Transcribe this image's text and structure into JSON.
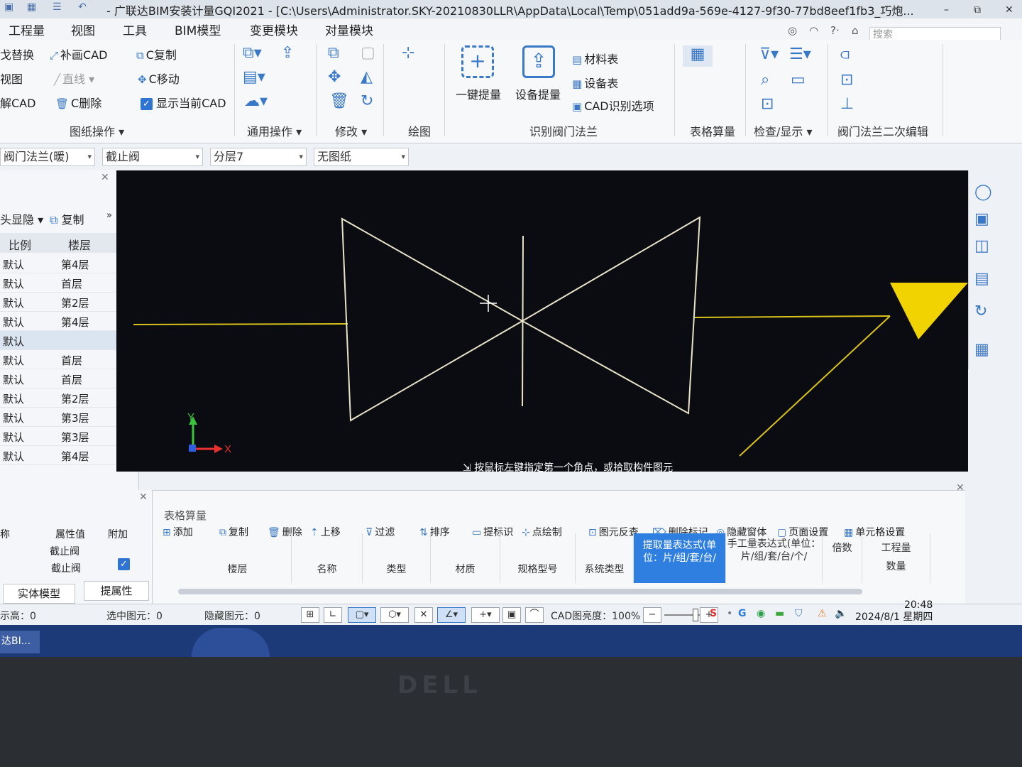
{
  "titlebar": {
    "title": "- 广联达BIM安装计量GQI2021 - [C:\\Users\\Administrator.SKY-20210830LLR\\AppData\\Local\\Temp\\051add9a-569e-4127-9f30-77bd8eef1fb3_巧炮...",
    "minimize": "–",
    "restore": "⧉",
    "close": "✕"
  },
  "menubar": {
    "items": [
      "工程量",
      "视图",
      "工具",
      "BIM模型",
      "变更模块",
      "对量模块"
    ],
    "search_placeholder": "搜索"
  },
  "ribbon": {
    "drawing": {
      "btn1": "戈替换",
      "btn2": "视图",
      "btn3": "解CAD",
      "btn4": "补画CAD",
      "btn5": "直线",
      "btn6": "C删除",
      "btn7": "C复制",
      "btn8": "C移动",
      "btn9": "显示当前CAD",
      "group": "图纸操作"
    },
    "general_group": "通用操作",
    "modify_group": "修改",
    "draw_group": "绘图",
    "recognize": {
      "one_key": "一键提量",
      "device": "设备提量",
      "material_table": "材料表",
      "device_table": "设备表",
      "cad_options": "CAD识别选项",
      "group": "识别阀门法兰"
    },
    "table_group": "表格算量",
    "check_group": "检查/显示",
    "secondary_group": "阀门法兰二次编辑"
  },
  "selectors": [
    "阀门法兰(暖)",
    "截止阀",
    "分层7",
    "无图纸"
  ],
  "leftpanel": {
    "toolbar": {
      "show_hide": "头显隐",
      "copy": "复制"
    },
    "headers": [
      "比例",
      "楼层"
    ],
    "rows": [
      {
        "scale": "默认",
        "floor": "第4层"
      },
      {
        "scale": "默认",
        "floor": "首层"
      },
      {
        "scale": "默认",
        "floor": "第2层"
      },
      {
        "scale": "默认",
        "floor": "第4层"
      },
      {
        "scale": "默认",
        "floor": ""
      },
      {
        "scale": "默认",
        "floor": "首层"
      },
      {
        "scale": "默认",
        "floor": "首层"
      },
      {
        "scale": "默认",
        "floor": "第2层"
      },
      {
        "scale": "默认",
        "floor": "第3层"
      },
      {
        "scale": "默认",
        "floor": "第3层"
      },
      {
        "scale": "默认",
        "floor": "第4层"
      }
    ]
  },
  "canvas": {
    "prompt": "按鼠标左键指定第一个角点，或拾取构件图元",
    "axis_x": "X",
    "axis_y": "Y"
  },
  "propanel": {
    "h_name": "称",
    "h_value": "属性值",
    "h_extra": "附加",
    "row1_value": "截止阀",
    "row2_value": "截止阀",
    "btn_solid": "实体模型",
    "btn_props": "提属性"
  },
  "tablepanel": {
    "title": "表格算量",
    "toolbar": [
      "添加",
      "复制",
      "删除",
      "上移",
      "过滤",
      "排序",
      "提标识",
      "点绘制",
      "图元反查",
      "删除标记",
      "隐藏窗体",
      "页面设置",
      "单元格设置"
    ],
    "columns": [
      "楼层",
      "名称",
      "类型",
      "材质",
      "规格型号",
      "系统类型"
    ],
    "col_extract": "提取量表达式(单位：片/组/套/台/",
    "col_manual": "手工量表达式(单位：片/组/套/台/个/",
    "col_multiple": "倍数",
    "col_qty_top": "工程量",
    "col_qty_bottom": "数量"
  },
  "statusbar": {
    "height": "示高：0",
    "selected": "选中图元：0",
    "hidden": "隐藏图元：0",
    "brightness": "CAD图亮度：100%"
  },
  "tray": {
    "time": "20:48",
    "date": "2024/8/1 星期四"
  },
  "taskbar": {
    "item": "达BI..."
  },
  "bezel": {
    "logo": "DELL"
  },
  "colors": {
    "accent": "#2f7fe0",
    "canvas": "#0b0c11",
    "cad_line": "#e8e2c8",
    "pipe": "#d9c21a",
    "marker": "#f0d300"
  }
}
